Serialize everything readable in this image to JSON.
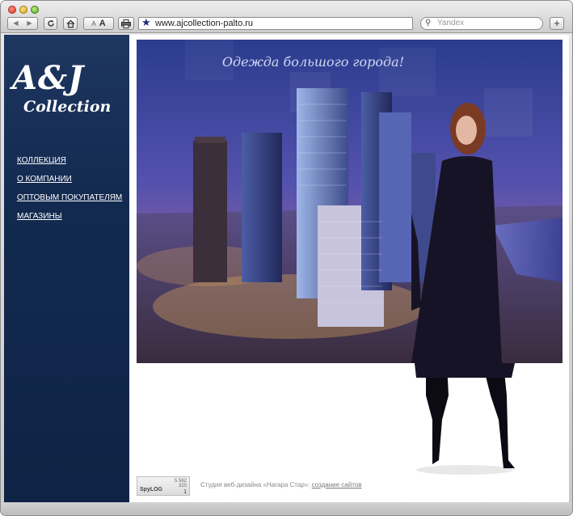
{
  "browser": {
    "address_url": "www.ajcollection-palto.ru",
    "search_placeholder": "Yandex",
    "font_small": "A",
    "font_big": "A",
    "plus": "+"
  },
  "site": {
    "logo_main": "A&J",
    "logo_sub": "Collection",
    "menu": [
      {
        "label": "КОЛЛЕКЦИЯ"
      },
      {
        "label": "О КОМПАНИИ"
      },
      {
        "label": "ОПТОВЫМ ПОКУПАТЕЛЯМ"
      },
      {
        "label": "МАГАЗИНЫ"
      }
    ],
    "hero_tagline": "Одежда большого города!"
  },
  "footer": {
    "counter": {
      "n1": "5 562",
      "n2": "320",
      "n3": "1",
      "logo": "SpyLOG"
    },
    "studio_text": "Студия веб-дизайна «Нагара Стар»: ",
    "link_text": "создание сайтов"
  }
}
